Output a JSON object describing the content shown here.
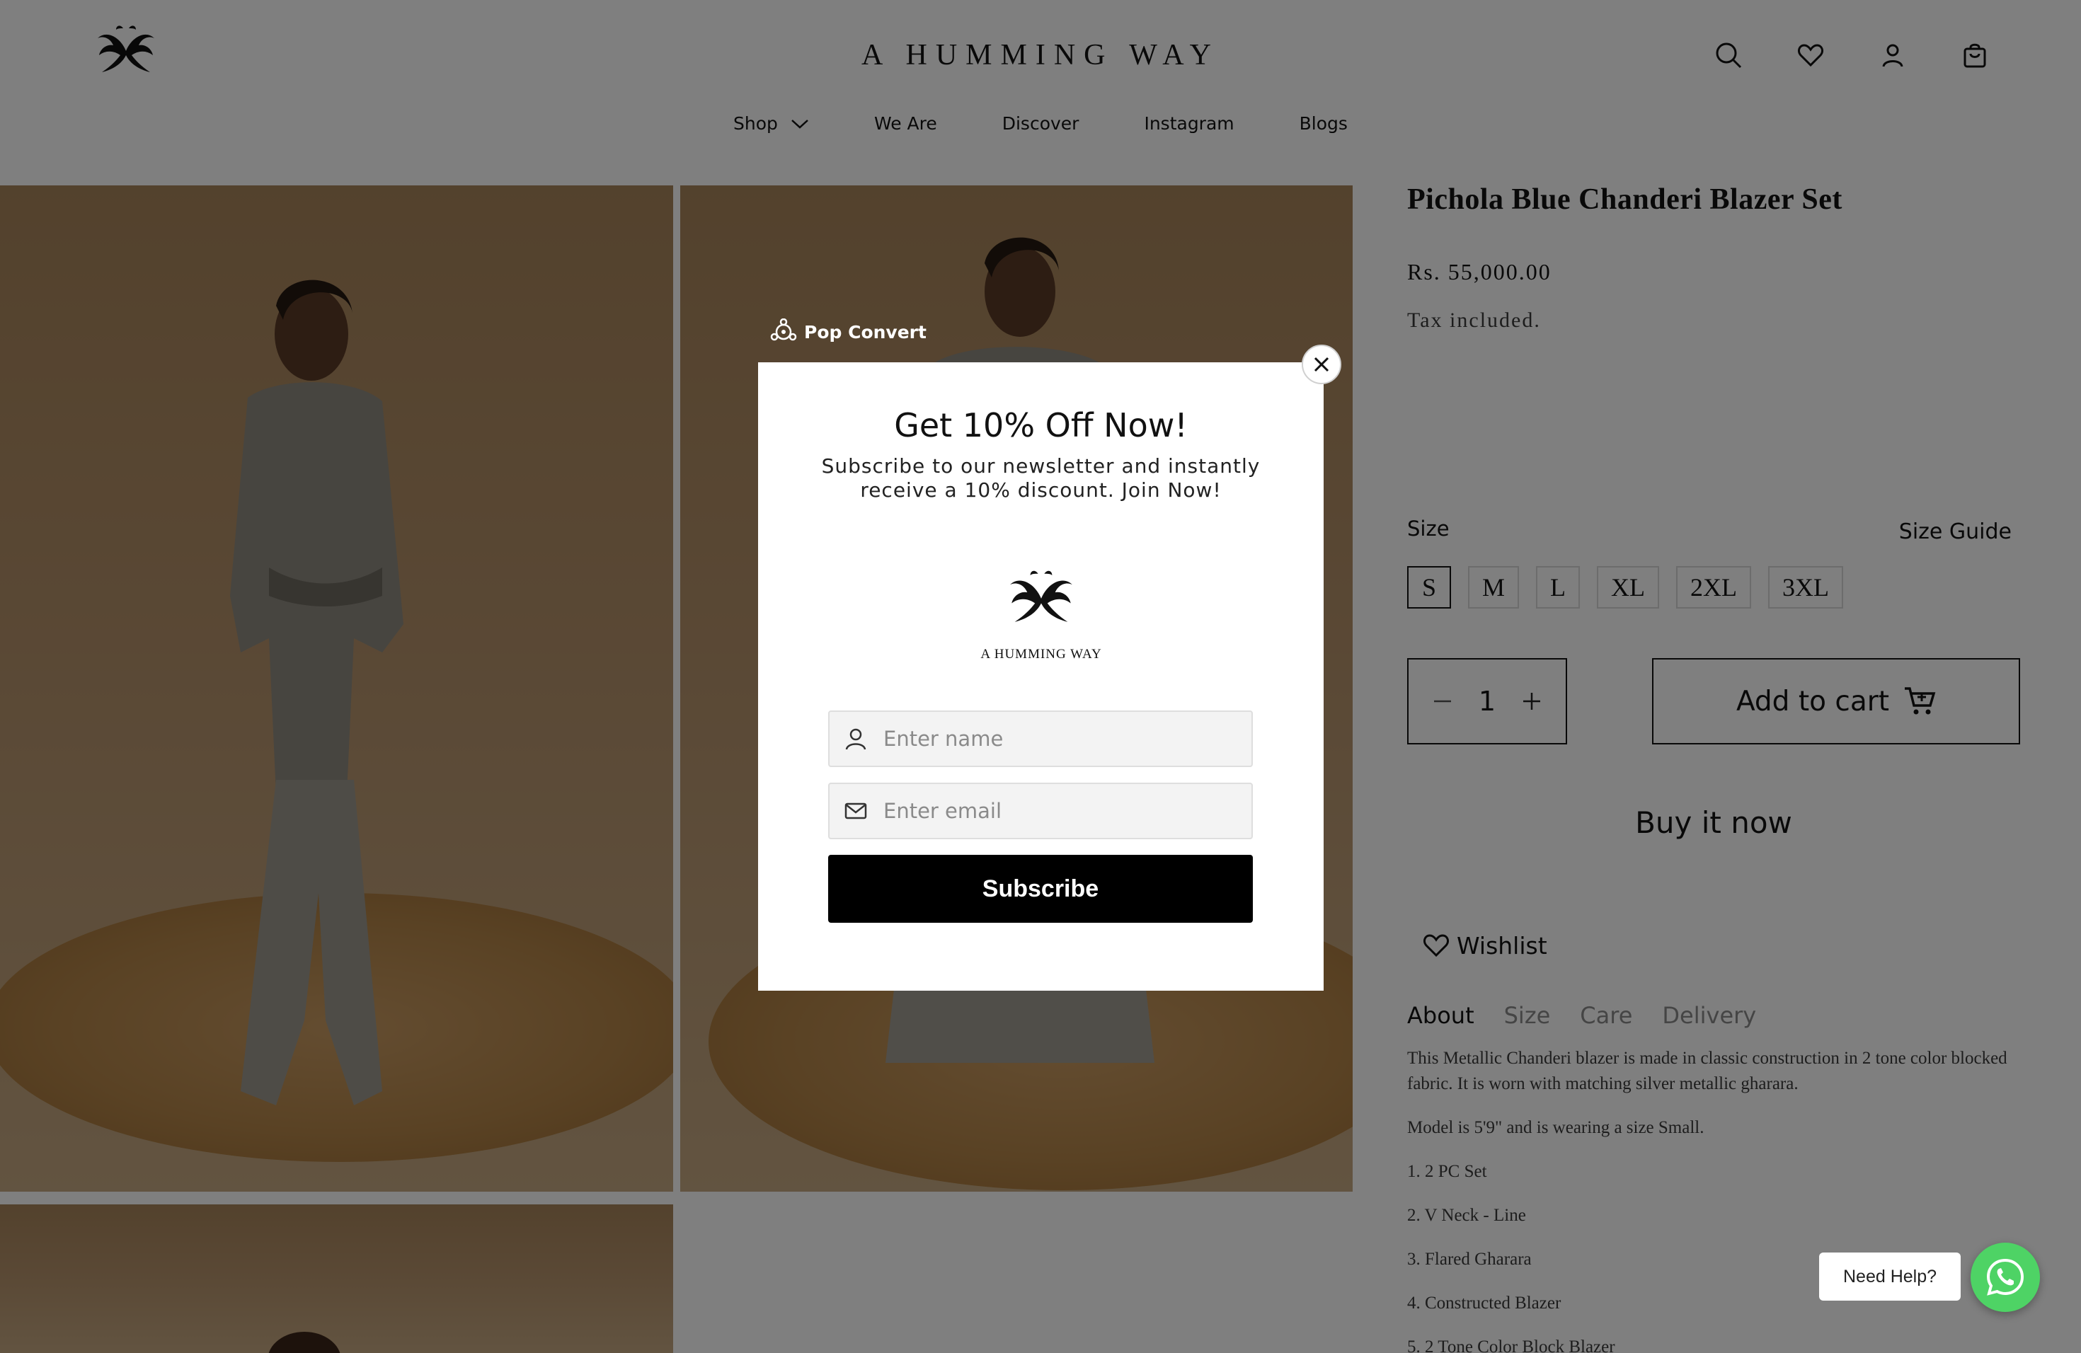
{
  "header": {
    "brand": "A HUMMING WAY",
    "nav": [
      {
        "label": "Shop"
      },
      {
        "label": "We Are"
      },
      {
        "label": "Discover"
      },
      {
        "label": "Instagram"
      },
      {
        "label": "Blogs"
      }
    ],
    "icons": [
      "search-icon",
      "heart-icon",
      "account-icon",
      "bag-icon"
    ]
  },
  "product": {
    "title": "Pichola Blue Chanderi Blazer Set",
    "price": "Rs. 55,000.00",
    "tax_note": "Tax included.",
    "size_label": "Size",
    "size_guide": "Size Guide",
    "sizes": [
      "S",
      "M",
      "L",
      "XL",
      "2XL",
      "3XL"
    ],
    "selected_size": "S",
    "quantity": "1",
    "add_to_cart": "Add to cart",
    "buy_now": "Buy it now",
    "wishlist": "Wishlist",
    "tabs": [
      "About",
      "Size",
      "Care",
      "Delivery"
    ],
    "active_tab": "About",
    "description": [
      "This Metallic Chanderi blazer is made in classic construction in 2 tone color blocked fabric. It is worn with matching silver metallic gharara.",
      "Model is 5'9\" and is wearing a size Small.",
      "1. 2 PC Set",
      "2. V Neck - Line",
      "3. Flared Gharara",
      "4. Constructed Blazer",
      "5. 2 Tone Color Block Blazer"
    ]
  },
  "popup": {
    "provider": "Pop Convert",
    "title": "Get 10% Off Now!",
    "subtitle": "Subscribe to our newsletter and instantly receive a 10% discount. Join Now!",
    "logo_text": "A HUMMING WAY",
    "name_placeholder": "Enter name",
    "email_placeholder": "Enter email",
    "subscribe_label": "Subscribe"
  },
  "help": {
    "label": "Need Help?"
  },
  "colors": {
    "overlay": "rgba(0,0,0,0.5)",
    "whatsapp": "#4ed365",
    "subscribe_bg": "#000000"
  }
}
